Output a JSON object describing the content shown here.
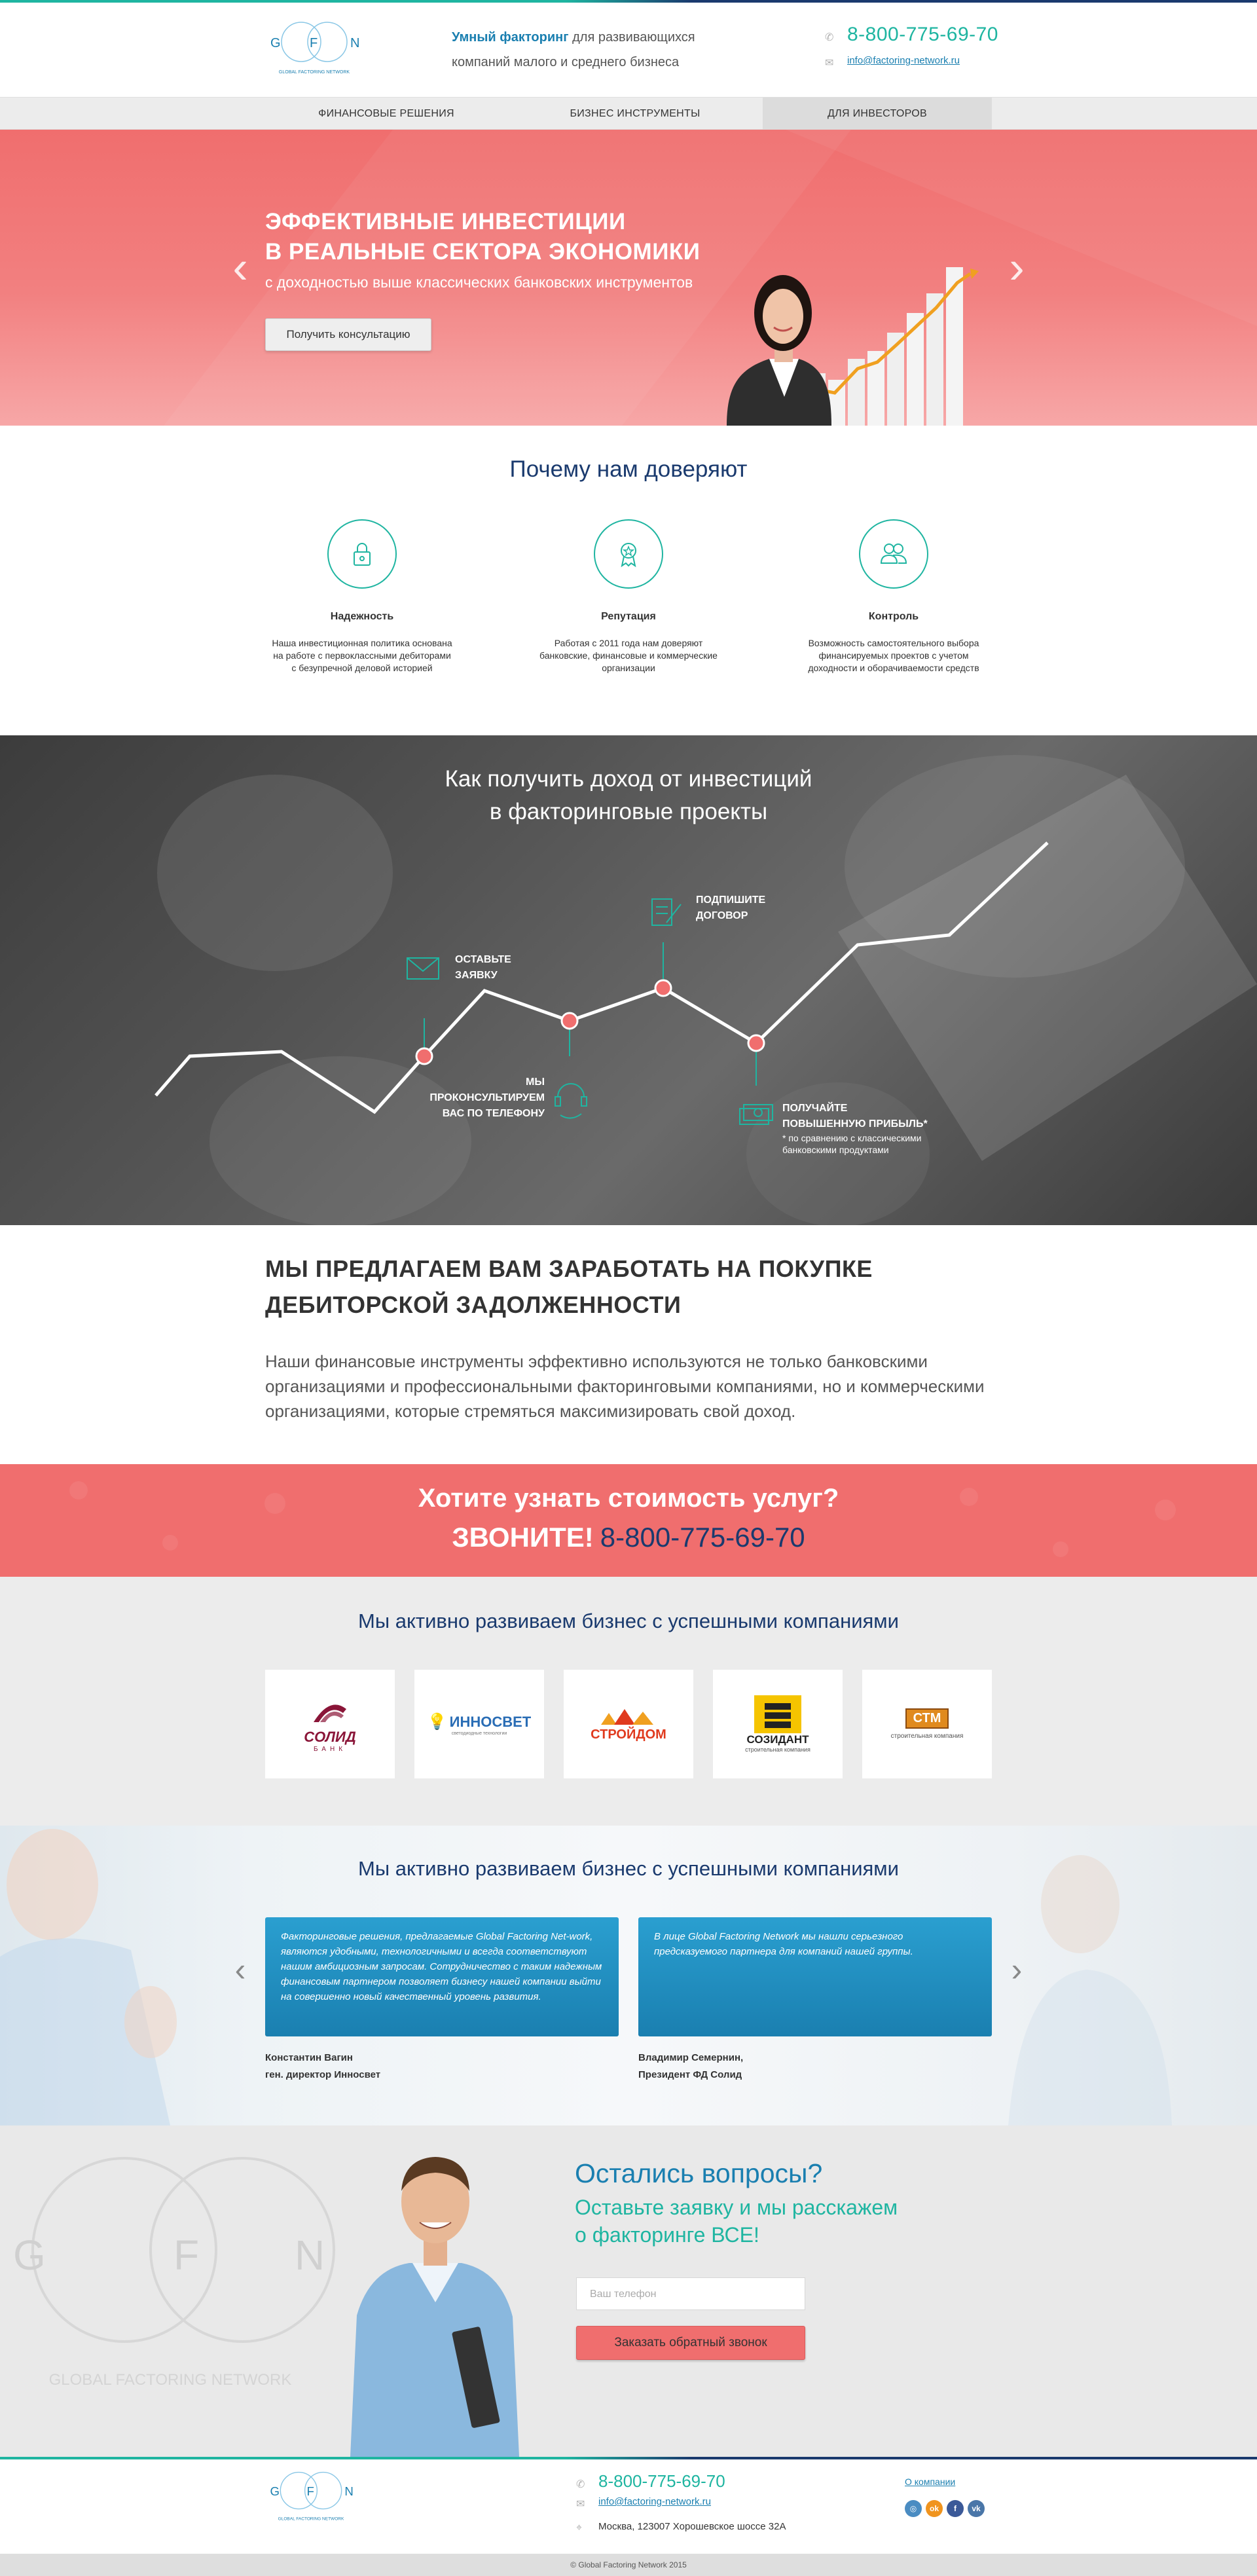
{
  "header": {
    "logo_letters": [
      "G",
      "F",
      "N"
    ],
    "logo_caption": "GLOBAL FACTORING NETWORK",
    "tagline_bold": "Умный факторинг",
    "tagline_rest_1": " для развивающихся",
    "tagline_line2": "компаний малого и среднего бизнеса",
    "phone_prefix": "8-800-",
    "phone_main": "775-69-70",
    "email": "info@factoring-network.ru"
  },
  "nav": {
    "items": [
      {
        "label": "ФИНАНСОВЫЕ РЕШЕНИЯ"
      },
      {
        "label": "БИЗНЕС ИНСТРУМЕНТЫ"
      },
      {
        "label": "ДЛЯ ИНВЕСТОРОВ"
      }
    ]
  },
  "hero": {
    "title_line1": "ЭФФЕКТИВНЫЕ ИНВЕСТИЦИИ",
    "title_line2": "В РЕАЛЬНЫЕ СЕКТОРА ЭКОНОМИКИ",
    "subtitle": "с доходностью выше классических банковских инструментов",
    "button": "Получить консультацию",
    "prev": "‹",
    "next": "›"
  },
  "trust": {
    "title": "Почему нам доверяют",
    "items": [
      {
        "icon": "lock-icon",
        "title": "Надежность",
        "text": "Наша инвестиционная политика основана на работе с первоклассными дебиторами с безупречной деловой историей"
      },
      {
        "icon": "award-icon",
        "title": "Репутация",
        "text": "Работая с 2011 года нам доверяют банковские, финансовые и коммерческие организации"
      },
      {
        "icon": "people-icon",
        "title": "Контроль",
        "text": "Возможность самостоятельного выбора финансируемых проектов с учетом доходности и оборачиваемости средств"
      }
    ]
  },
  "how": {
    "title_line1": "Как получить доход от инвестиций",
    "title_line2": "в факторинговые проекты",
    "step1_l1": "ОСТАВЬТЕ",
    "step1_l2": "ЗАЯВКУ",
    "step2_l1": "МЫ",
    "step2_l2": "ПРОКОНСУЛЬТИРУЕМ",
    "step2_l3": "ВАС ПО ТЕЛЕФОНУ",
    "step3_l1": "ПОДПИШИТЕ",
    "step3_l2": "ДОГОВОР",
    "step4_l1": "ПОЛУЧАЙТЕ",
    "step4_l2": "ПОВЫШЕННУЮ ПРИБЫЛЬ*",
    "step4_note_l1": "* по сравнению с классическими",
    "step4_note_l2": "банковскими продуктами"
  },
  "offer": {
    "title_line1": "МЫ ПРЕДЛАГАЕМ ВАМ ЗАРАБОТАТЬ НА ПОКУПКЕ",
    "title_line2": "ДЕБИТОРСКОЙ ЗАДОЛЖЕННОСТИ",
    "text": "Наши финансовые инструменты эффективно используются не только банковскими организациями и профессиональными факторинговыми компаниями, но и коммерческими организациями, которые стремяться максимизировать свой доход."
  },
  "call": {
    "line1": "Хотите узнать стоимость услуг?",
    "call_word": "ЗВОНИТЕ!",
    "phone": "8-800-775-69-70"
  },
  "partners": {
    "title": "Мы активно развиваем бизнес с успешными компаниями",
    "items": [
      {
        "name": "СОЛИД",
        "sub": "БАНК",
        "color": "#8a1538"
      },
      {
        "name": "ИННОСВЕТ",
        "sub": "светодиодные технологии",
        "color": "#2a6db5"
      },
      {
        "name": "СТРОЙДОМ",
        "sub": "",
        "color": "#e03a1e"
      },
      {
        "name": "СОЗИДАНТ",
        "sub": "строительная компания",
        "color": "#222222"
      },
      {
        "name": "СТМ",
        "sub": "строительная компания",
        "color": "#e08a1e"
      }
    ]
  },
  "reviews": {
    "title": "Мы активно развиваем бизнес с успешными компаниями",
    "items": [
      {
        "text": "Факторинговые решения, предлагаемые Global Factoring Net-work, являются удобными, технологичными и всегда соответствуют нашим амбициозным запросам. Сотрудничество с таким надежным финансовым партнером позволяет бизнесу нашей компании выйти на совершенно новый качественный уровень развития.",
        "name_l1": "Константин Вагин",
        "name_l2": "ген. директор Инносвет"
      },
      {
        "text": "В лице Global Factoring Network мы нашли серьезного предсказуемого партнера для компаний нашей группы.",
        "name_l1": "Владимир Семернин,",
        "name_l2": "Президент ФД Солид"
      }
    ],
    "prev": "‹",
    "next": "›"
  },
  "contact": {
    "title": "Остались вопросы?",
    "sub_line1": "Оставьте заявку и мы расскажем",
    "sub_line2_a": "о факторинге ",
    "sub_line2_b": "ВСЕ!",
    "phone_placeholder": "Ваш телефон",
    "button": "Заказать обратный звонок",
    "bg_letters": [
      "G",
      "F",
      "N"
    ],
    "bg_caption": "GLOBAL FACTORING NETWORK"
  },
  "footer": {
    "phone_prefix": "8-800-",
    "phone_main": "775-69-70",
    "email": "info@factoring-network.ru",
    "address": "Москва, 123007 Хорошевское шоссе 32А",
    "about_link": "О компании",
    "social": [
      {
        "icon": "instagram-icon",
        "glyph": "◎",
        "color": "#4a8cc2"
      },
      {
        "icon": "odnoklassniki-icon",
        "glyph": "ok",
        "color": "#f0941e"
      },
      {
        "icon": "facebook-icon",
        "glyph": "f",
        "color": "#3b5998"
      },
      {
        "icon": "vk-icon",
        "glyph": "vk",
        "color": "#4a76a8"
      }
    ],
    "copyright": "© Global Factoring Network 2015"
  },
  "colors": {
    "teal": "#1fb5a1",
    "navy": "#1a3a6e",
    "blue": "#1a7fb0",
    "coral": "#f06e6e"
  }
}
